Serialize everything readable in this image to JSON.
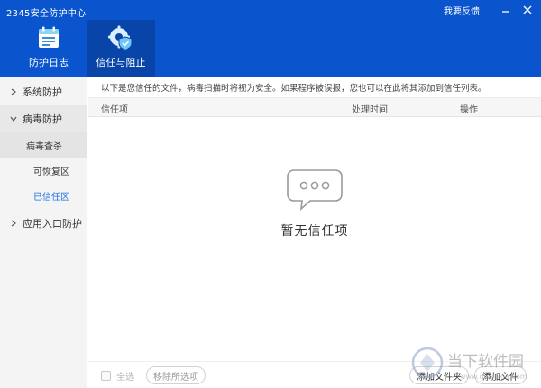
{
  "app": {
    "title": "2345安全防护中心"
  },
  "window": {
    "feedback": "我要反馈"
  },
  "nav": {
    "tabs": [
      {
        "label": "防护日志",
        "icon": "log-icon"
      },
      {
        "label": "信任与阻止",
        "icon": "trust-shield-gear-icon"
      }
    ],
    "active_tab": "信任与阻止"
  },
  "sidebar": {
    "groups": [
      {
        "label": "系统防护",
        "expanded": false
      },
      {
        "label": "病毒防护",
        "expanded": true,
        "items": [
          "病毒查杀",
          "可恢复区",
          "已信任区"
        ]
      },
      {
        "label": "应用入口防护",
        "expanded": false
      }
    ],
    "active_item": "已信任区"
  },
  "main": {
    "info": "以下是您信任的文件，病毒扫描时将视为安全。如果程序被误报，您也可以在此将其添加到信任列表。",
    "columns": {
      "name": "信任项",
      "time": "处理时间",
      "op": "操作"
    },
    "empty_text": "暂无信任项"
  },
  "footer": {
    "select_all": "全选",
    "remove_selected": "移除所选项",
    "add_folder": "添加文件夹",
    "add_file": "添加文件"
  },
  "watermark": {
    "brand": "当下软件园",
    "url": "www.downxia.com"
  },
  "colors": {
    "header": "#0a55ce",
    "active_tab": "#0944a8",
    "active_link": "#1f6ee5"
  }
}
